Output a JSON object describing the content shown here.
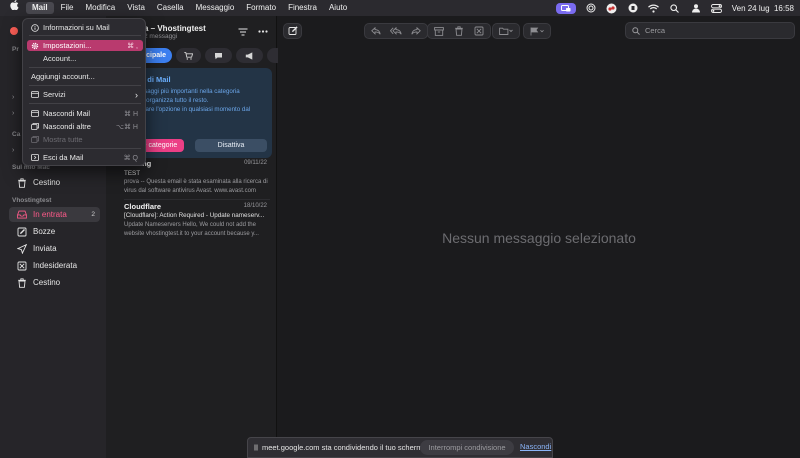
{
  "menubar": {
    "items": [
      "Mail",
      "File",
      "Modifica",
      "Vista",
      "Casella",
      "Messaggio",
      "Formato",
      "Finestra",
      "Aiuto"
    ],
    "datetime": "Ven 24 lug  16:58",
    "icons": [
      "apple-icon",
      "screen-share-icon",
      "focus-icon",
      "shazam-icon",
      "vpn-icon",
      "wifi-icon",
      "search-icon",
      "user-icon",
      "control-center-icon"
    ]
  },
  "mail_menu": {
    "items": [
      {
        "label": "Informazioni su Mail",
        "shortcut": ""
      },
      {
        "label": "Impostazioni...",
        "shortcut": "⌘ ,"
      },
      {
        "label": "Account...",
        "shortcut": ""
      },
      {
        "label": "Aggiungi account...",
        "shortcut": ""
      },
      {
        "label": "Servizi",
        "shortcut": "›"
      },
      {
        "label": "Nascondi Mail",
        "shortcut": "⌘ H"
      },
      {
        "label": "Nascondi altre",
        "shortcut": "⌥⌘ H"
      },
      {
        "label": "Mostra tutte",
        "shortcut": ""
      },
      {
        "label": "Esci da Mail",
        "shortcut": "⌘ Q"
      }
    ]
  },
  "sidebar": {
    "partial_labels": [
      "Pr",
      "Ca"
    ],
    "section_local": "Sul mio Mac",
    "section_account": "Vhostingtest",
    "local_items": [
      {
        "label": "Cestino"
      }
    ],
    "account_items": [
      {
        "label": "In entrata",
        "badge": "2"
      },
      {
        "label": "Bozze"
      },
      {
        "label": "Inviata"
      },
      {
        "label": "Indesiderata"
      },
      {
        "label": "Cestino"
      }
    ]
  },
  "list": {
    "title": "a – Vhostingtest",
    "subtitle": "2 messaggi",
    "tab_principale": "cipale",
    "banner": {
      "title": "e di Mail",
      "line1": "ssaggi più importanti nella categoria",
      "line2": "e organizza tutto il resto.",
      "line3": "ivare l'opzione in qualsiasi momento dal",
      "line4": "i.",
      "btn_categories": "e categorie",
      "btn_disable": "Disattiva"
    },
    "messages": [
      {
        "sender": "ing",
        "date": "09/11/22",
        "subject": "TEST",
        "preview": "prova -- Questa email è stata esaminata alla ricerca di virus dal software antivirus Avast. www.avast.com"
      },
      {
        "sender": "Cloudflare",
        "date": "18/10/22",
        "subject": "[Cloudflare]: Action Required - Update nameserv...",
        "preview": "Update Nameservers Hello, We could not add the website vhostingtest.it to your account because y..."
      }
    ]
  },
  "toolbar": {
    "search_placeholder": "Cerca"
  },
  "detail": {
    "empty_text": "Nessun messaggio selezionato"
  },
  "share_bar": {
    "text": "meet.google.com sta condividendo il tuo schermo.",
    "stop_label": "Interrompi condivisione",
    "hide_label": "Nascondi"
  },
  "colors": {
    "accent": "#ec3f86",
    "selected_blue": "#3c7ff0",
    "menu_highlight": "#b93a6e"
  }
}
